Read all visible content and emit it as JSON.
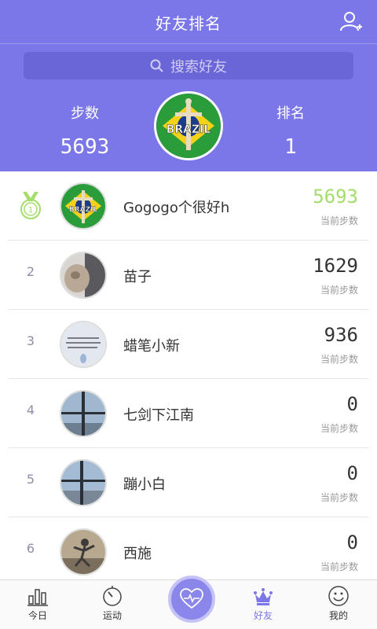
{
  "header": {
    "title": "好友排名"
  },
  "search": {
    "placeholder": "搜索好友"
  },
  "stats": {
    "steps_label": "步数",
    "steps_value": "5693",
    "rank_label": "排名",
    "rank_value": "1"
  },
  "list": [
    {
      "rank": "1",
      "name": "Gogogo个很好h",
      "steps": "5693",
      "sublabel": "当前步数"
    },
    {
      "rank": "2",
      "name": "苗子",
      "steps": "1629",
      "sublabel": "当前步数"
    },
    {
      "rank": "3",
      "name": "蜡笔小新",
      "steps": "936",
      "sublabel": "当前步数"
    },
    {
      "rank": "4",
      "name": "七剑下江南",
      "steps": "0",
      "sublabel": "当前步数"
    },
    {
      "rank": "5",
      "name": "蹦小白",
      "steps": "0",
      "sublabel": "当前步数"
    },
    {
      "rank": "6",
      "name": "西施",
      "steps": "0",
      "sublabel": "当前步数"
    }
  ],
  "tabs": [
    {
      "label": "今日",
      "icon": "bar-chart-icon"
    },
    {
      "label": "运动",
      "icon": "timer-icon"
    },
    {
      "label": "",
      "icon": "heart-pulse-icon"
    },
    {
      "label": "好友",
      "icon": "crown-icon"
    },
    {
      "label": "我的",
      "icon": "smile-icon"
    }
  ],
  "brazil_badge": "BRAZIL",
  "colors": {
    "primary": "#7b77e8",
    "highlight": "#a4dd6a"
  }
}
